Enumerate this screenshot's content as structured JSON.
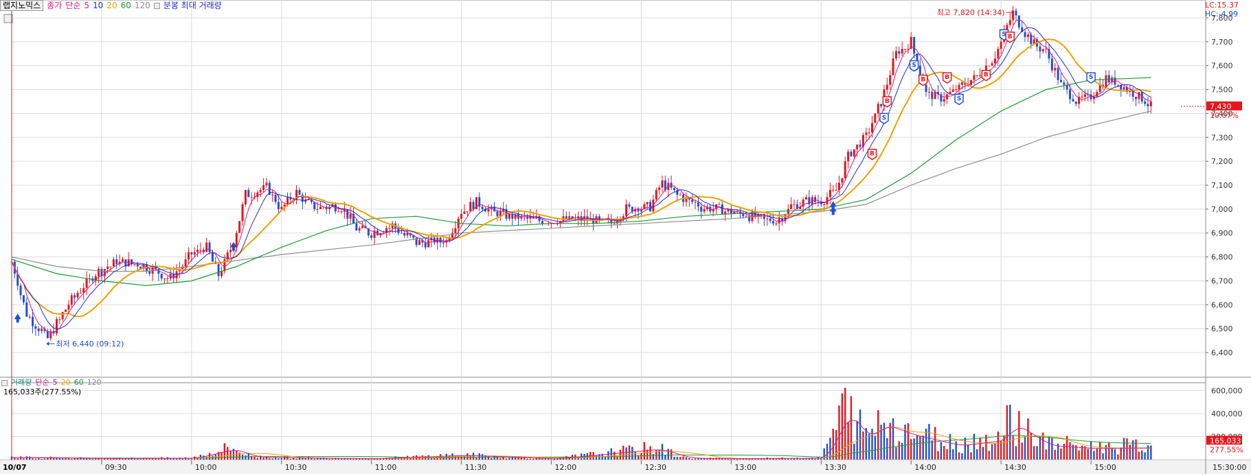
{
  "header": {
    "stock_name": "랩지노믹스",
    "price_label": "종가",
    "ma_type_label": "단순",
    "ma_periods": [
      "5",
      "10",
      "20",
      "60",
      "120"
    ],
    "overlay_label": "분봉 최대 거래량",
    "lc_label": "LC:15.37",
    "hc_label": "HC:-4.99"
  },
  "volume_header": {
    "title": "거래량",
    "ma_type_label": "단순",
    "ma_periods": [
      "5",
      "20",
      "60",
      "120"
    ],
    "current_volume": "165,033주(277.55%)"
  },
  "colors": {
    "up": "#e8151b",
    "down": "#1f4fd6",
    "ma5": "#e0148c",
    "ma10": "#1f2ec8",
    "ma20": "#f0a000",
    "ma60": "#1b9a34",
    "ma120": "#8c8c8c",
    "grid": "#dcdcdc"
  },
  "chart_data": [
    {
      "type": "candlestick",
      "date": "10/07",
      "x_ticks": [
        "09:30",
        "10:00",
        "10:30",
        "11:00",
        "11:30",
        "12:00",
        "12:30",
        "13:00",
        "13:30",
        "14:00",
        "14:30",
        "15:00",
        "15:30:00"
      ],
      "y_ticks": [
        "6,400",
        "6,500",
        "6,600",
        "6,700",
        "6,800",
        "6,900",
        "7,000",
        "7,100",
        "7,200",
        "7,300",
        "7,400",
        "7,500",
        "7,600",
        "7,700",
        "7,800"
      ],
      "ylim": [
        6360,
        7840
      ],
      "time_range": [
        "09:00",
        "15:30"
      ],
      "grid": true,
      "close_path": [
        [
          "09:00",
          6780
        ],
        [
          "09:05",
          6560
        ],
        [
          "09:12",
          6460
        ],
        [
          "09:20",
          6620
        ],
        [
          "09:28",
          6730
        ],
        [
          "09:35",
          6780
        ],
        [
          "09:45",
          6760
        ],
        [
          "09:53",
          6710
        ],
        [
          "10:00",
          6810
        ],
        [
          "10:05",
          6840
        ],
        [
          "10:09",
          6720
        ],
        [
          "10:14",
          6860
        ],
        [
          "10:18",
          7060
        ],
        [
          "10:25",
          7090
        ],
        [
          "10:30",
          7000
        ],
        [
          "10:35",
          7070
        ],
        [
          "10:40",
          7010
        ],
        [
          "10:50",
          7010
        ],
        [
          "10:55",
          6920
        ],
        [
          "11:00",
          6900
        ],
        [
          "11:07",
          6930
        ],
        [
          "11:15",
          6860
        ],
        [
          "11:25",
          6870
        ],
        [
          "11:30",
          6990
        ],
        [
          "11:35",
          7030
        ],
        [
          "11:40",
          6990
        ],
        [
          "11:50",
          6960
        ],
        [
          "12:00",
          6950
        ],
        [
          "12:10",
          6960
        ],
        [
          "12:20",
          6940
        ],
        [
          "12:25",
          7000
        ],
        [
          "12:33",
          7010
        ],
        [
          "12:37",
          7110
        ],
        [
          "12:42",
          7060
        ],
        [
          "12:50",
          7010
        ],
        [
          "13:00",
          6990
        ],
        [
          "13:10",
          6960
        ],
        [
          "13:15",
          6950
        ],
        [
          "13:20",
          7010
        ],
        [
          "13:25",
          7030
        ],
        [
          "13:31",
          7040
        ],
        [
          "13:35",
          7080
        ],
        [
          "13:39",
          7220
        ],
        [
          "13:45",
          7300
        ],
        [
          "13:50",
          7450
        ],
        [
          "13:55",
          7650
        ],
        [
          "14:00",
          7700
        ],
        [
          "14:05",
          7480
        ],
        [
          "14:10",
          7460
        ],
        [
          "14:15",
          7500
        ],
        [
          "14:22",
          7560
        ],
        [
          "14:28",
          7640
        ],
        [
          "14:34",
          7820
        ],
        [
          "14:40",
          7700
        ],
        [
          "14:45",
          7660
        ],
        [
          "14:50",
          7520
        ],
        [
          "14:55",
          7450
        ],
        [
          "15:00",
          7470
        ],
        [
          "15:05",
          7550
        ],
        [
          "15:10",
          7520
        ],
        [
          "15:15",
          7480
        ],
        [
          "15:20",
          7430
        ]
      ],
      "ma60": [
        [
          "09:00",
          6790
        ],
        [
          "09:15",
          6730
        ],
        [
          "09:30",
          6700
        ],
        [
          "09:45",
          6680
        ],
        [
          "10:00",
          6700
        ],
        [
          "10:15",
          6760
        ],
        [
          "10:30",
          6840
        ],
        [
          "10:45",
          6910
        ],
        [
          "11:00",
          6960
        ],
        [
          "11:15",
          6970
        ],
        [
          "11:30",
          6940
        ],
        [
          "11:45",
          6930
        ],
        [
          "12:00",
          6940
        ],
        [
          "12:15",
          6940
        ],
        [
          "12:30",
          6950
        ],
        [
          "12:45",
          6970
        ],
        [
          "13:00",
          6980
        ],
        [
          "13:15",
          6990
        ],
        [
          "13:30",
          7000
        ],
        [
          "13:45",
          7040
        ],
        [
          "14:00",
          7150
        ],
        [
          "14:15",
          7290
        ],
        [
          "14:30",
          7410
        ],
        [
          "14:45",
          7500
        ],
        [
          "15:00",
          7540
        ],
        [
          "15:20",
          7550
        ]
      ],
      "ma120": [
        [
          "09:00",
          6800
        ],
        [
          "09:15",
          6760
        ],
        [
          "09:30",
          6740
        ],
        [
          "09:45",
          6740
        ],
        [
          "10:00",
          6760
        ],
        [
          "10:30",
          6810
        ],
        [
          "11:00",
          6850
        ],
        [
          "11:30",
          6900
        ],
        [
          "12:00",
          6920
        ],
        [
          "12:30",
          6940
        ],
        [
          "13:00",
          6960
        ],
        [
          "13:30",
          6990
        ],
        [
          "13:45",
          7020
        ],
        [
          "14:00",
          7100
        ],
        [
          "14:15",
          7170
        ],
        [
          "14:30",
          7230
        ],
        [
          "14:45",
          7300
        ],
        [
          "15:00",
          7350
        ],
        [
          "15:20",
          7410
        ]
      ],
      "annotations": {
        "high_label": "최고 7,820 (14:34)",
        "low_label": "최저 6,440 (09:12)",
        "current_price": "7,430",
        "change_rate": "10.07%"
      },
      "signals": [
        {
          "time": "09:02",
          "type": "buy-arrow",
          "price": 6540
        },
        {
          "time": "10:14",
          "type": "buy-arrow",
          "price": 6840
        },
        {
          "time": "13:34",
          "type": "buy-arrow",
          "price": 7010
        },
        {
          "time": "13:34",
          "type": "buy-arrow",
          "price": 6990
        },
        {
          "time": "13:47",
          "type": "B",
          "price": 7230
        },
        {
          "time": "13:51",
          "type": "S",
          "price": 7380
        },
        {
          "time": "13:52",
          "type": "B",
          "price": 7450
        },
        {
          "time": "14:01",
          "type": "S",
          "price": 7600
        },
        {
          "time": "14:04",
          "type": "B",
          "price": 7540
        },
        {
          "time": "14:12",
          "type": "B",
          "price": 7550
        },
        {
          "time": "14:16",
          "type": "S",
          "price": 7460
        },
        {
          "time": "14:25",
          "type": "B",
          "price": 7560
        },
        {
          "time": "14:31",
          "type": "S",
          "price": 7730
        },
        {
          "time": "14:33",
          "type": "B",
          "price": 7720
        },
        {
          "time": "15:00",
          "type": "S",
          "price": 7550
        }
      ]
    },
    {
      "type": "bar",
      "title": "거래량",
      "y_ticks": [
        "200,000",
        "400,000",
        "600,000"
      ],
      "ylim": [
        0,
        680000
      ],
      "current_volume_label": "165,033",
      "current_ratio_label": "277.55%",
      "volume_profile": [
        [
          "09:00",
          30000
        ],
        [
          "09:30",
          15000
        ],
        [
          "10:00",
          20000
        ],
        [
          "10:13",
          150000
        ],
        [
          "10:20",
          40000
        ],
        [
          "10:30",
          25000
        ],
        [
          "11:00",
          12000
        ],
        [
          "11:30",
          60000
        ],
        [
          "12:00",
          10000
        ],
        [
          "12:35",
          150000
        ],
        [
          "12:45",
          20000
        ],
        [
          "13:00",
          12000
        ],
        [
          "13:30",
          20000
        ],
        [
          "13:38",
          660000
        ],
        [
          "13:45",
          300000
        ],
        [
          "13:50",
          500000
        ],
        [
          "14:00",
          350000
        ],
        [
          "14:15",
          200000
        ],
        [
          "14:30",
          280000
        ],
        [
          "14:33",
          520000
        ],
        [
          "14:45",
          200000
        ],
        [
          "15:00",
          160000
        ],
        [
          "15:20",
          170000
        ]
      ]
    }
  ]
}
